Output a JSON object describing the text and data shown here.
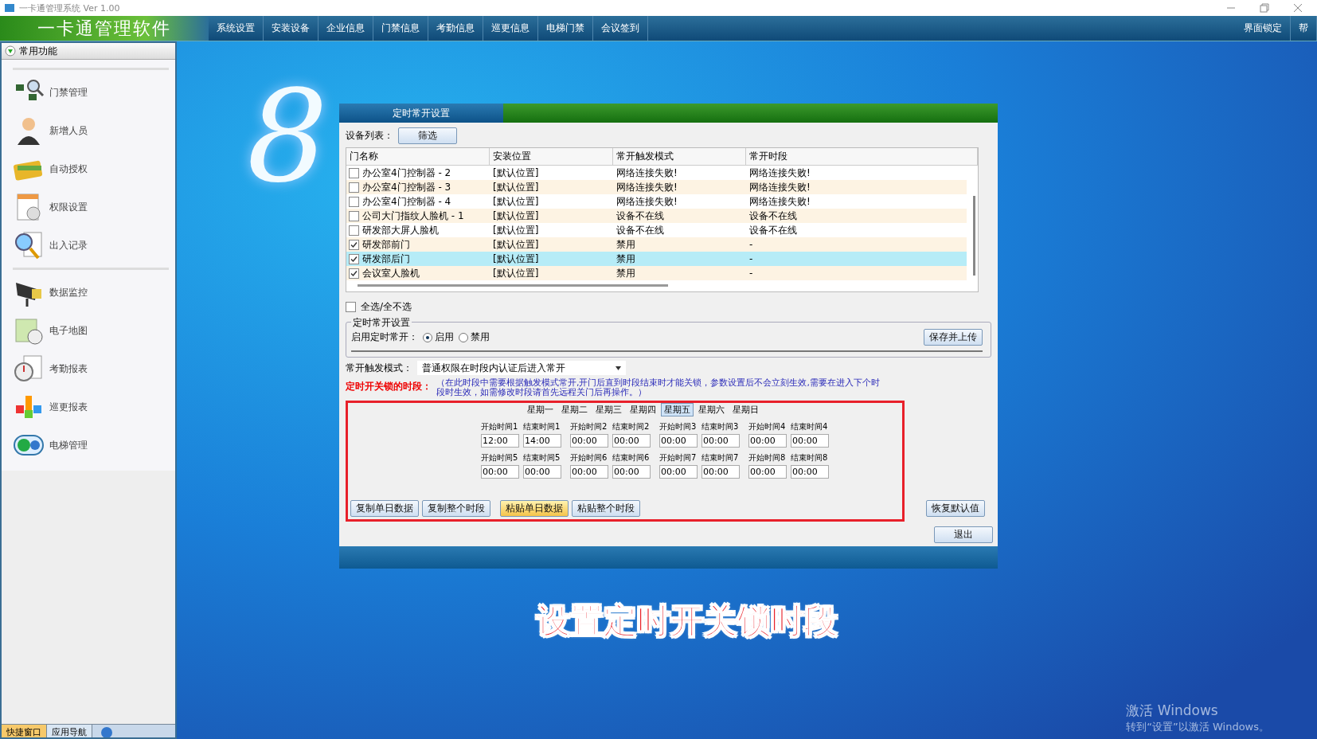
{
  "window": {
    "title": "一卡通管理系统  Ver 1.00"
  },
  "app_title": "一卡通管理软件",
  "menu": [
    "系统设置",
    "安装设备",
    "企业信息",
    "门禁信息",
    "考勤信息",
    "巡更信息",
    "电梯门禁",
    "会议签到"
  ],
  "menu_right": [
    "界面锁定",
    "帮"
  ],
  "sidebar": {
    "header": "常用功能",
    "groups": [
      [
        {
          "label": "门禁管理",
          "kind": "chips"
        },
        {
          "label": "新增人员",
          "kind": "person"
        },
        {
          "label": "自动授权",
          "kind": "cards"
        },
        {
          "label": "权限设置",
          "kind": "document"
        },
        {
          "label": "出入记录",
          "kind": "magnifier"
        }
      ],
      [
        {
          "label": "数据监控",
          "kind": "camera"
        },
        {
          "label": "电子地图",
          "kind": "map"
        },
        {
          "label": "考勤报表",
          "kind": "clock"
        },
        {
          "label": "巡更报表",
          "kind": "blocks"
        },
        {
          "label": "电梯管理",
          "kind": "elevator"
        }
      ]
    ],
    "bottom_tabs": [
      {
        "label": "快捷窗口",
        "selected": true
      },
      {
        "label": "应用导航",
        "selected": false
      }
    ]
  },
  "logo_text": "8",
  "dialog": {
    "tab": "定时常开设置",
    "device_list_label": "设备列表：",
    "filter_button": "筛选",
    "table": {
      "columns": [
        "门名称",
        "安装位置",
        "常开触发模式",
        "常开时段"
      ],
      "rows": [
        {
          "checked": false,
          "selected": false,
          "cells": [
            "办公室4门控制器 - 2",
            "[默认位置]",
            "网络连接失败!",
            "网络连接失败!"
          ]
        },
        {
          "checked": false,
          "selected": false,
          "cells": [
            "办公室4门控制器 - 3",
            "[默认位置]",
            "网络连接失败!",
            "网络连接失败!"
          ]
        },
        {
          "checked": false,
          "selected": false,
          "cells": [
            "办公室4门控制器 - 4",
            "[默认位置]",
            "网络连接失败!",
            "网络连接失败!"
          ]
        },
        {
          "checked": false,
          "selected": false,
          "cells": [
            "公司大门指纹人脸机 - 1",
            "[默认位置]",
            "设备不在线",
            "设备不在线"
          ]
        },
        {
          "checked": false,
          "selected": false,
          "cells": [
            "研发部大屏人脸机",
            "[默认位置]",
            "设备不在线",
            "设备不在线"
          ]
        },
        {
          "checked": true,
          "selected": false,
          "cells": [
            "研发部前门",
            "[默认位置]",
            "禁用",
            "-"
          ]
        },
        {
          "checked": true,
          "selected": true,
          "cells": [
            "研发部后门",
            "[默认位置]",
            "禁用",
            "-"
          ]
        },
        {
          "checked": true,
          "selected": false,
          "cells": [
            "会议室人脸机",
            "[默认位置]",
            "禁用",
            "-"
          ]
        }
      ]
    },
    "select_all": {
      "label": "全选/全不选",
      "checked": false
    },
    "group_title": "定时常开设置",
    "enable": {
      "label": "启用定时常开：",
      "options": [
        {
          "label": "启用",
          "selected": true
        },
        {
          "label": "禁用",
          "selected": false
        }
      ]
    },
    "save_button": "保存并上传",
    "trigger_mode": {
      "label": "常开触发模式：",
      "value": "普通权限在时段内认证后进入常开"
    },
    "period_label": "定时开关锁的时段：",
    "period_note": "（在此时段中需要根据触发模式常开,开门后直到时段结束时才能关锁，参数设置后不会立刻生效,需要在进入下个时段时生效，如需修改时段请首先远程关门后再操作。）",
    "days": [
      {
        "label": "星期一",
        "selected": false
      },
      {
        "label": "星期二",
        "selected": false
      },
      {
        "label": "星期三",
        "selected": false
      },
      {
        "label": "星期四",
        "selected": false
      },
      {
        "label": "星期五",
        "selected": true
      },
      {
        "label": "星期六",
        "selected": false
      },
      {
        "label": "星期日",
        "selected": false
      }
    ],
    "slots": [
      {
        "label": "开始时间1",
        "value": "12:00"
      },
      {
        "label": "结束时间1",
        "value": "14:00"
      },
      {
        "label": "开始时间2",
        "value": "00:00"
      },
      {
        "label": "结束时间2",
        "value": "00:00"
      },
      {
        "label": "开始时间3",
        "value": "00:00"
      },
      {
        "label": "结束时间3",
        "value": "00:00"
      },
      {
        "label": "开始时间4",
        "value": "00:00"
      },
      {
        "label": "结束时间4",
        "value": "00:00"
      },
      {
        "label": "开始时间5",
        "value": "00:00"
      },
      {
        "label": "结束时间5",
        "value": "00:00"
      },
      {
        "label": "开始时间6",
        "value": "00:00"
      },
      {
        "label": "结束时间6",
        "value": "00:00"
      },
      {
        "label": "开始时间7",
        "value": "00:00"
      },
      {
        "label": "结束时间7",
        "value": "00:00"
      },
      {
        "label": "开始时间8",
        "value": "00:00"
      },
      {
        "label": "结束时间8",
        "value": "00:00"
      }
    ],
    "actions": [
      {
        "label": "复制单日数据",
        "highlighted": false
      },
      {
        "label": "复制整个时段",
        "highlighted": false
      },
      {
        "label": "粘贴单日数据",
        "highlighted": true
      },
      {
        "label": "粘贴整个时段",
        "highlighted": false
      }
    ],
    "restore_button": "恢复默认值",
    "exit_button": "退出"
  },
  "caption": "设置定时开关锁时段",
  "activation": {
    "title": "激活 Windows",
    "hint": "转到“设置”以激活 Windows。"
  }
}
